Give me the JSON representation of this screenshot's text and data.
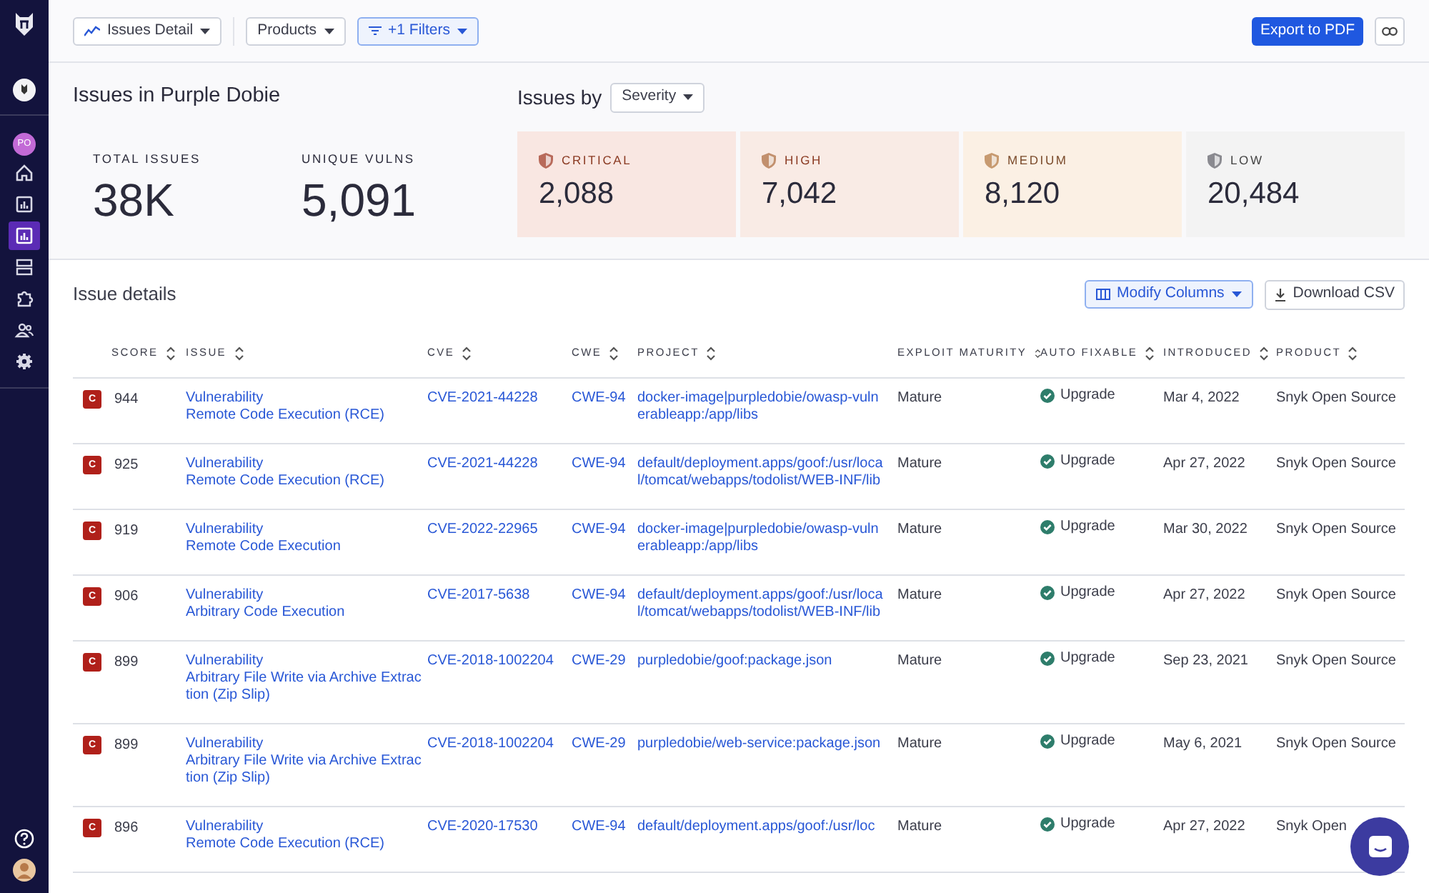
{
  "toolbar": {
    "view_dropdown": "Issues Detail",
    "products_dropdown": "Products",
    "filters_dropdown": "+1 Filters",
    "export_button": "Export to PDF"
  },
  "summary": {
    "title": "Issues in Purple Dobie",
    "group_label": "Issues by",
    "group_dropdown": "Severity",
    "totals": [
      {
        "label": "TOTAL ISSUES",
        "value": "38K"
      },
      {
        "label": "UNIQUE VULNS",
        "value": "5,091"
      }
    ],
    "severities": [
      {
        "kind": "critical",
        "label": "CRITICAL",
        "value": "2,088"
      },
      {
        "kind": "high",
        "label": "HIGH",
        "value": "7,042"
      },
      {
        "kind": "medium",
        "label": "MEDIUM",
        "value": "8,120"
      },
      {
        "kind": "low",
        "label": "LOW",
        "value": "20,484"
      }
    ]
  },
  "sidebar": {
    "org_avatar": "PO",
    "items": [
      {
        "selected": false
      },
      {
        "selected": false
      },
      {
        "selected": true
      },
      {
        "selected": false
      },
      {
        "selected": false
      },
      {
        "selected": false
      },
      {
        "selected": false
      }
    ]
  },
  "table": {
    "title": "Issue details",
    "modify_columns_button": "Modify Columns",
    "download_button": "Download CSV",
    "columns": [
      "SCORE",
      "ISSUE",
      "CVE",
      "CWE",
      "PROJECT",
      "EXPLOIT MATURITY",
      "AUTO FIXABLE",
      "INTRODUCED",
      "PRODUCT"
    ],
    "rows": [
      {
        "badge": "C",
        "score": "944",
        "issue_type": "Vulnerability",
        "issue_title": "Remote Code Execution (RCE)",
        "cve": "CVE-2021-44228",
        "cwe": "CWE-94",
        "project": "docker-image|purpledobie/owasp-vulnerableapp:/app/libs",
        "exploit": "Mature",
        "fixable": true,
        "fix": "Upgrade",
        "introduced": "Mar 4, 2022",
        "product": "Snyk Open Source"
      },
      {
        "badge": "C",
        "score": "925",
        "issue_type": "Vulnerability",
        "issue_title": "Remote Code Execution (RCE)",
        "cve": "CVE-2021-44228",
        "cwe": "CWE-94",
        "project": "default/deployment.apps/goof:/usr/local/tomcat/webapps/todolist/WEB-INF/lib",
        "exploit": "Mature",
        "fixable": true,
        "fix": "Upgrade",
        "introduced": "Apr 27, 2022",
        "product": "Snyk Open Source"
      },
      {
        "badge": "C",
        "score": "919",
        "issue_type": "Vulnerability",
        "issue_title": "Remote Code Execution",
        "cve": "CVE-2022-22965",
        "cwe": "CWE-94",
        "project": "docker-image|purpledobie/owasp-vulnerableapp:/app/libs",
        "exploit": "Mature",
        "fixable": true,
        "fix": "Upgrade",
        "introduced": "Mar 30, 2022",
        "product": "Snyk Open Source"
      },
      {
        "badge": "C",
        "score": "906",
        "issue_type": "Vulnerability",
        "issue_title": "Arbitrary Code Execution",
        "cve": "CVE-2017-5638",
        "cwe": "CWE-94",
        "project": "default/deployment.apps/goof:/usr/local/tomcat/webapps/todolist/WEB-INF/lib",
        "exploit": "Mature",
        "fixable": true,
        "fix": "Upgrade",
        "introduced": "Apr 27, 2022",
        "product": "Snyk Open Source"
      },
      {
        "badge": "C",
        "score": "899",
        "issue_type": "Vulnerability",
        "issue_title": "Arbitrary File Write via Archive Extraction (Zip Slip)",
        "cve": "CVE-2018-1002204",
        "cwe": "CWE-29",
        "project": "purpledobie/goof:package.json",
        "exploit": "Mature",
        "fixable": true,
        "fix": "Upgrade",
        "introduced": "Sep 23, 2021",
        "product": "Snyk Open Source"
      },
      {
        "badge": "C",
        "score": "899",
        "issue_type": "Vulnerability",
        "issue_title": "Arbitrary File Write via Archive Extraction (Zip Slip)",
        "cve": "CVE-2018-1002204",
        "cwe": "CWE-29",
        "project": "purpledobie/web-service:package.json",
        "exploit": "Mature",
        "fixable": true,
        "fix": "Upgrade",
        "introduced": "May 6, 2021",
        "product": "Snyk Open Source"
      },
      {
        "badge": "C",
        "score": "896",
        "issue_type": "Vulnerability",
        "issue_title": "Remote Code Execution (RCE)",
        "cve": "CVE-2020-17530",
        "cwe": "CWE-94",
        "project": "default/deployment.apps/goof:/usr/loc",
        "exploit": "Mature",
        "fixable": true,
        "fix": "Upgrade",
        "introduced": "Apr 27, 2022",
        "product": "Snyk Open"
      }
    ]
  }
}
